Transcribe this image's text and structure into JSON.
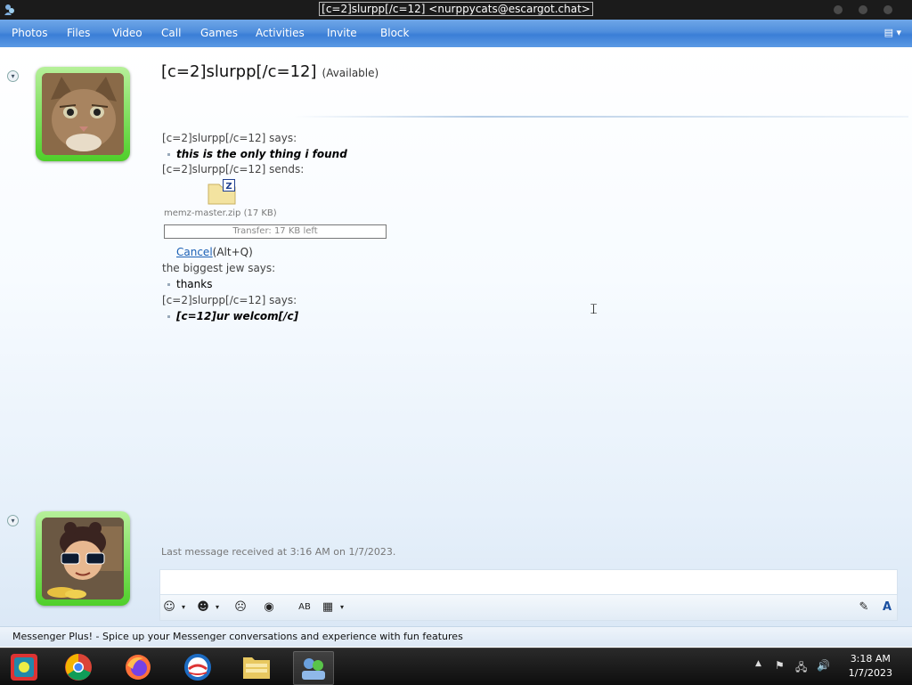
{
  "window": {
    "title": "[c=2]slurpp[/c=12] <nurppycats@escargot.chat>"
  },
  "menu": {
    "items": [
      "Photos",
      "Files",
      "Video",
      "Call",
      "Games",
      "Activities",
      "Invite",
      "Block"
    ]
  },
  "contact": {
    "name": "[c=2]slurpp[/c=12]",
    "status": "(Available)"
  },
  "messages": {
    "m1_head": "[c=2]slurpp[/c=12] says:",
    "m1_text": "this is the only thing i found",
    "m2_head": "[c=2]slurpp[/c=12] sends:",
    "file_name": "memz-master.zip (17 KB)",
    "transfer_text": "Transfer: 17 KB left",
    "cancel_label": "Cancel",
    "cancel_hotkey": "(Alt+Q)",
    "m3_head": "the biggest jew says:",
    "m3_text": "thanks",
    "m4_head": "[c=2]slurpp[/c=12] says:",
    "m4_text": "[c=12]ur welcom[/c]"
  },
  "status_bar": {
    "last_message": "Last message received at 3:16 AM on 1/7/2023."
  },
  "plus_banner": {
    "text": "Messenger Plus! - Spice up your Messenger conversations and experience with fun features"
  },
  "taskbar": {
    "time": "3:18 AM",
    "date": "1/7/2023",
    "apps": [
      "windows-live-messenger-app",
      "chrome",
      "firefox",
      "internet-explorer",
      "file-explorer",
      "messenger-active"
    ]
  },
  "colors": {
    "menubar": "#4e8ddc",
    "avatar_frame": "#4fcf2a",
    "link": "#1a5fb4"
  }
}
